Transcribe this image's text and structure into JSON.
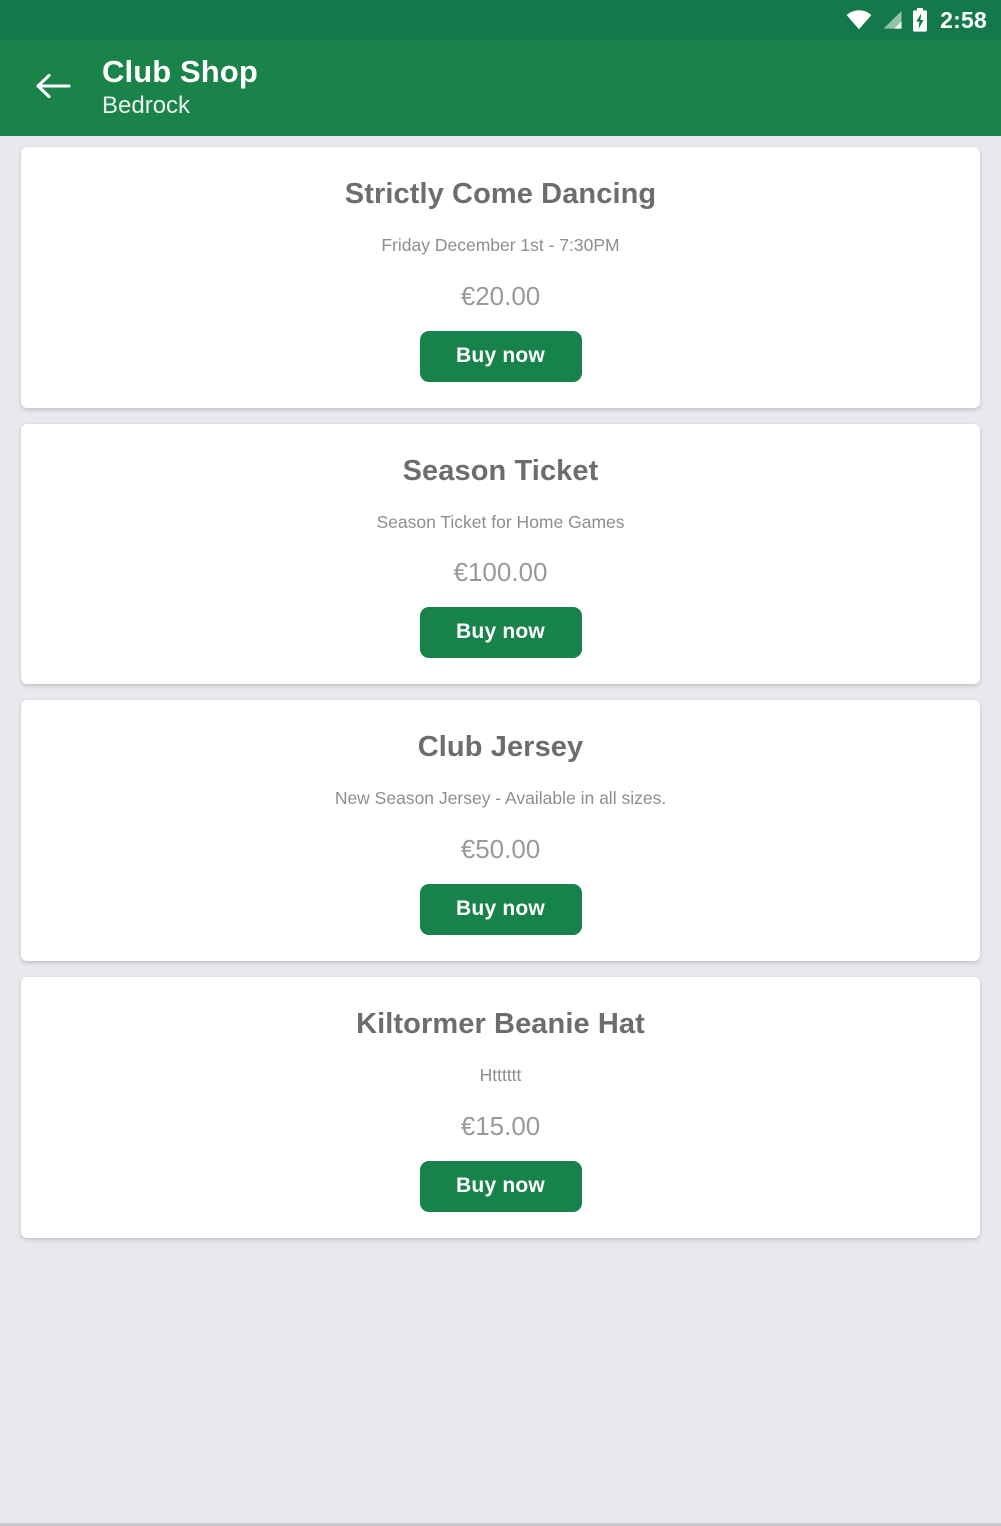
{
  "status_bar": {
    "time": "2:58",
    "icons": [
      "wifi-icon",
      "signal-icon",
      "battery-charging-icon"
    ],
    "background_color": "#13794a"
  },
  "app_bar": {
    "back_icon": "back-arrow-icon",
    "title": "Club Shop",
    "subtitle": "Bedrock",
    "background_color": "#1a8349"
  },
  "theme": {
    "page_background": "#e9e8ed",
    "card_background": "#ffffff",
    "accent_green": "#17824a",
    "title_text": "#6d6d6d",
    "body_text": "#8e8e8e",
    "price_text": "#9a9a9a"
  },
  "products": [
    {
      "title": "Strictly Come Dancing",
      "description": "Friday December 1st - 7:30PM",
      "price": "€20.00",
      "buy_label": "Buy now"
    },
    {
      "title": "Season Ticket",
      "description": "Season Ticket for Home Games",
      "price": "€100.00",
      "buy_label": "Buy now"
    },
    {
      "title": "Club Jersey",
      "description": "New Season Jersey - Available in all sizes.",
      "price": "€50.00",
      "buy_label": "Buy now"
    },
    {
      "title": "Kiltormer Beanie Hat",
      "description": "Htttttt",
      "price": "€15.00",
      "buy_label": "Buy now"
    }
  ]
}
